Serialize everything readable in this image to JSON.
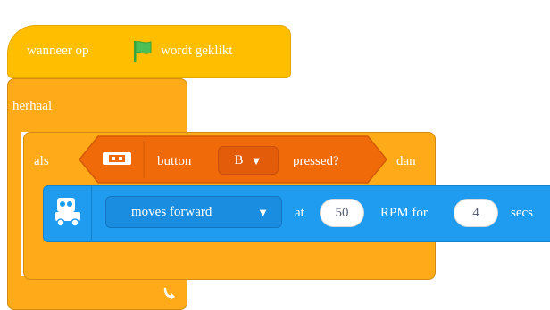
{
  "hat_block": {
    "text_before": "wanneer op",
    "flag_icon": "green-flag-icon",
    "text_after": "wordt geklikt"
  },
  "repeat_block": {
    "label": "herhaal",
    "loop_icon": "loop-arrow-icon"
  },
  "if_block": {
    "label_if": "als",
    "label_then": "dan",
    "condition": {
      "device_icon": "button-device-icon",
      "label": "button",
      "dropdown_value": "B",
      "label_after": "pressed?"
    }
  },
  "motion_block": {
    "robot_icon": "robot-icon",
    "dropdown_value": "moves forward",
    "label_at": "at",
    "rpm_value": "50",
    "label_rpm_for": "RPM for",
    "secs_value": "4",
    "label_secs": "secs"
  },
  "colors": {
    "event": "#ffbf00",
    "control": "#ffab19",
    "sensing_hex": "#f06a0a",
    "motion": "#1f9cf0"
  }
}
